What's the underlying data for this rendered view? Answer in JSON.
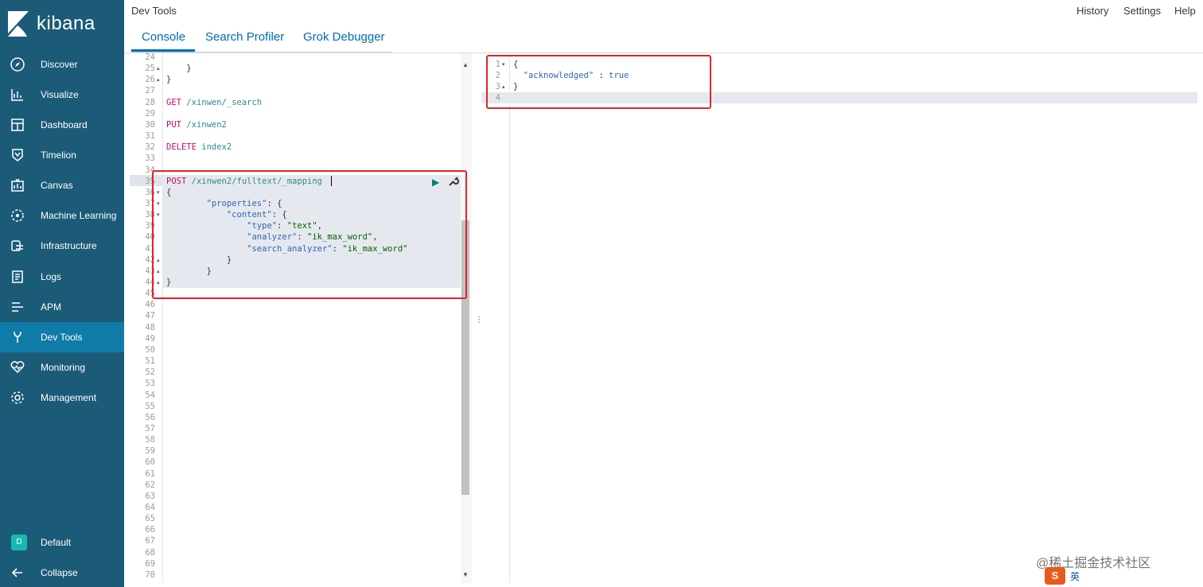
{
  "brand": {
    "name": "kibana",
    "accent": "#006bb4",
    "sidebar_bg": "#1b5b78",
    "active_bg": "#0f7ca7"
  },
  "sidebar": {
    "items": [
      {
        "label": "Discover",
        "icon": "compass-icon"
      },
      {
        "label": "Visualize",
        "icon": "chart-icon"
      },
      {
        "label": "Dashboard",
        "icon": "dashboard-icon"
      },
      {
        "label": "Timelion",
        "icon": "timelion-icon"
      },
      {
        "label": "Canvas",
        "icon": "canvas-icon"
      },
      {
        "label": "Machine Learning",
        "icon": "ml-icon"
      },
      {
        "label": "Infrastructure",
        "icon": "infrastructure-icon"
      },
      {
        "label": "Logs",
        "icon": "logs-icon"
      },
      {
        "label": "APM",
        "icon": "apm-icon"
      },
      {
        "label": "Dev Tools",
        "icon": "wrench-icon",
        "active": true
      },
      {
        "label": "Monitoring",
        "icon": "heartbeat-icon"
      },
      {
        "label": "Management",
        "icon": "gear-icon"
      }
    ],
    "space": {
      "badge": "D",
      "label": "Default"
    },
    "collapse_label": "Collapse"
  },
  "header": {
    "title": "Dev Tools",
    "links": {
      "history": "History",
      "settings": "Settings",
      "help": "Help"
    },
    "tabs": [
      {
        "label": "Console",
        "active": true
      },
      {
        "label": "Search Profiler"
      },
      {
        "label": "Grok Debugger"
      }
    ]
  },
  "editor": {
    "lines": [
      {
        "n": "24",
        "text": ""
      },
      {
        "n": "25",
        "text": "    }"
      },
      {
        "n": "26",
        "text": "}"
      },
      {
        "n": "27",
        "text": ""
      },
      {
        "n": "28",
        "method": "GET",
        "url": "/xinwen/_search"
      },
      {
        "n": "29",
        "text": ""
      },
      {
        "n": "30",
        "method": "PUT",
        "url": "/xinwen2"
      },
      {
        "n": "31",
        "text": ""
      },
      {
        "n": "32",
        "method": "DELETE",
        "url": "index2"
      },
      {
        "n": "33",
        "text": ""
      },
      {
        "n": "34",
        "text": ""
      },
      {
        "n": "35",
        "method": "POST",
        "url": "/xinwen2/fulltext/_mapping"
      },
      {
        "n": "36",
        "text": "{"
      },
      {
        "n": "37",
        "key": "\"properties\"",
        "pre": "        ",
        "post": ": {"
      },
      {
        "n": "38",
        "key": "\"content\"",
        "pre": "            ",
        "post": ": {"
      },
      {
        "n": "39",
        "key": "\"type\"",
        "pre": "                ",
        "post": ": ",
        "val": "\"text\"",
        "tail": ","
      },
      {
        "n": "40",
        "key": "\"analyzer\"",
        "pre": "                ",
        "post": ": ",
        "val": "\"ik_max_word\"",
        "tail": ","
      },
      {
        "n": "41",
        "key": "\"search_analyzer\"",
        "pre": "                ",
        "post": ": ",
        "val": "\"ik_max_word\"",
        "tail": ""
      },
      {
        "n": "42",
        "text": "            }"
      },
      {
        "n": "43",
        "text": "        }"
      },
      {
        "n": "44",
        "text": "}"
      },
      {
        "n": "45",
        "text": ""
      },
      {
        "n": "46"
      },
      {
        "n": "47"
      },
      {
        "n": "48"
      },
      {
        "n": "49"
      },
      {
        "n": "50"
      },
      {
        "n": "51"
      },
      {
        "n": "52"
      },
      {
        "n": "53"
      },
      {
        "n": "54"
      },
      {
        "n": "55"
      },
      {
        "n": "56"
      },
      {
        "n": "57"
      },
      {
        "n": "58"
      },
      {
        "n": "59"
      },
      {
        "n": "60"
      },
      {
        "n": "61"
      },
      {
        "n": "62"
      },
      {
        "n": "63"
      },
      {
        "n": "64"
      },
      {
        "n": "65"
      },
      {
        "n": "66"
      },
      {
        "n": "67"
      },
      {
        "n": "68"
      },
      {
        "n": "69"
      },
      {
        "n": "70"
      }
    ]
  },
  "output": {
    "lines": [
      {
        "n": "1",
        "text": "{"
      },
      {
        "n": "2",
        "key": "\"acknowledged\"",
        "pre": "  ",
        "post": " : ",
        "val": "true"
      },
      {
        "n": "3",
        "text": "}"
      },
      {
        "n": "4",
        "text": ""
      }
    ]
  },
  "watermark": "@稀土掘金技术社区",
  "tray": {
    "ime": "S",
    "lang": "英"
  }
}
